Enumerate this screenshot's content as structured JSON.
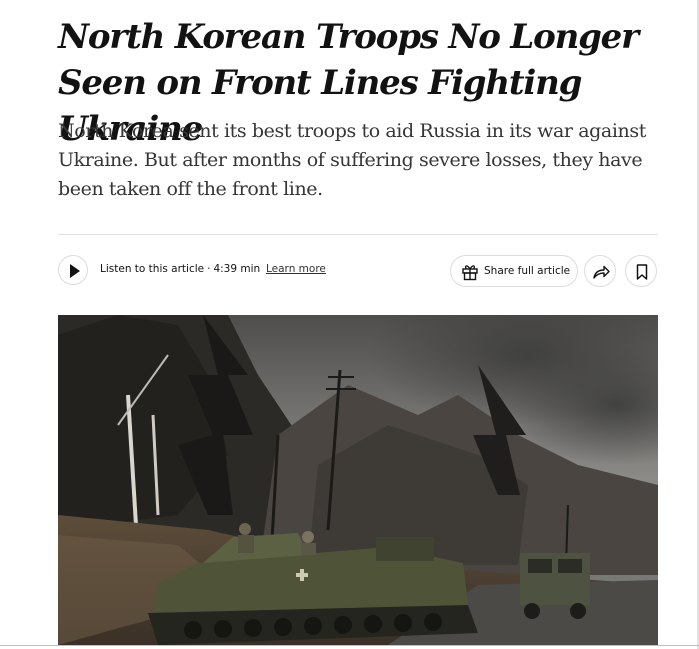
{
  "article": {
    "headline": "North Korean Troops No Longer Seen on Front Lines Fighting Ukraine",
    "summary": "North Korea sent its best troops to aid Russia in its war against Ukraine. But after months of suffering severe losses, they have been taken off the front line."
  },
  "toolbar": {
    "listen_label": "Listen to this article",
    "separator": "·",
    "duration": "4:39 min",
    "learn_more": "Learn more",
    "share_full_label": "Share full article"
  },
  "icons": {
    "play": "play-icon",
    "gift": "gift-icon",
    "share": "share-arrow-icon",
    "bookmark": "bookmark-icon"
  },
  "colors": {
    "text": "#121212",
    "summary_text": "#363636",
    "border": "#dcdcdc"
  }
}
